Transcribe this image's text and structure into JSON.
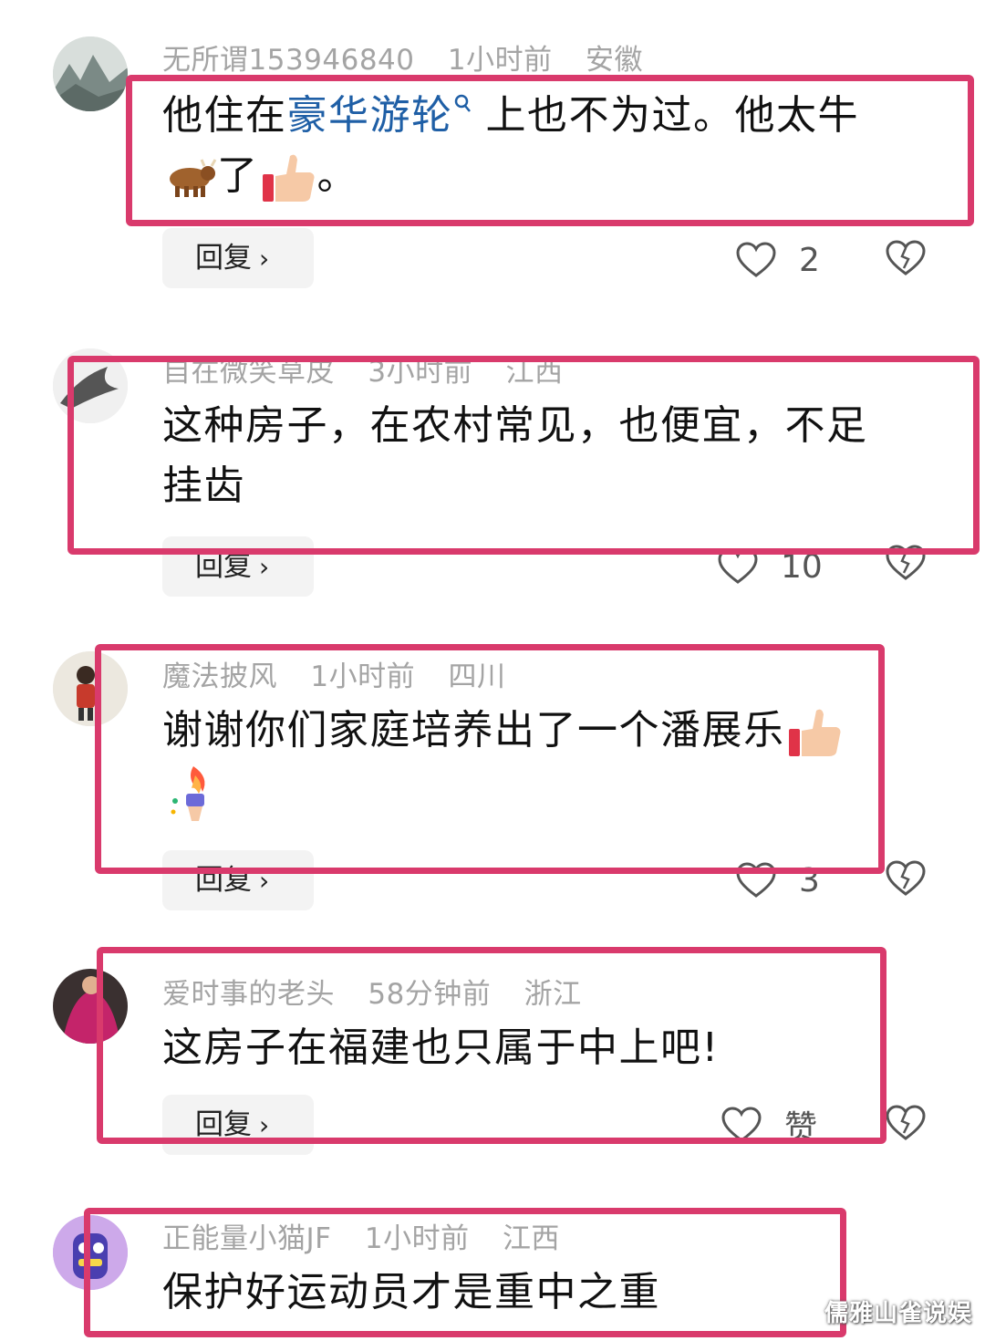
{
  "comments": [
    {
      "user": "无所谓153946840",
      "time": "1小时前",
      "location": "安徽",
      "text_prefix": "他住在",
      "link_text": "豪华游轮",
      "text_suffix": "上也不为过。他太牛",
      "line2_text": "了",
      "line2_end": "。",
      "reply_label": "回复",
      "likes": "2"
    },
    {
      "user": "自在微笑草皮",
      "time": "3小时前",
      "location": "江西",
      "text_line1": "这种房子，在农村常见，也便宜，不足",
      "text_line2": "挂齿",
      "reply_label": "回复",
      "likes": "10"
    },
    {
      "user": "魔法披风",
      "time": "1小时前",
      "location": "四川",
      "text_line1": "谢谢你们家庭培养出了一个潘展乐",
      "reply_label": "回复",
      "likes": "3"
    },
    {
      "user": "爱时事的老头",
      "time": "58分钟前",
      "location": "浙江",
      "text_line1": "这房子在福建也只属于中上吧!",
      "reply_label": "回复",
      "likes": "赞"
    },
    {
      "user": "正能量小猫JF",
      "time": "1小时前",
      "location": "江西",
      "text_line1": "保护好运动员才是重中之重"
    }
  ],
  "watermark": "儒雅山雀说娱",
  "icons": {
    "like": "heart-outline-icon",
    "dislike": "broken-heart-icon",
    "search": "search-icon",
    "reply_chevron": "chevron-right-icon"
  },
  "colors": {
    "highlight_frame": "#d93a6c",
    "link": "#1f5fa6",
    "meta": "#a4a4a4"
  }
}
